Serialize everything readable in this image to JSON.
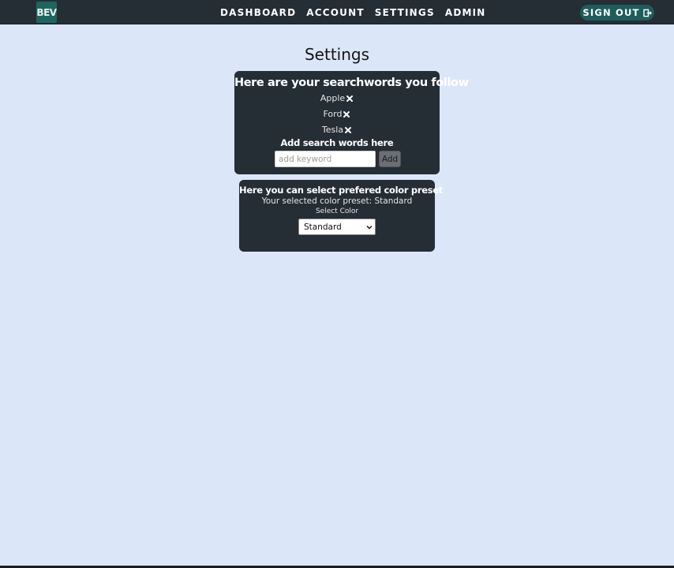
{
  "nav": {
    "logo": "BEV",
    "links": [
      "DASHBOARD",
      "ACCOUNT",
      "SETTINGS",
      "ADMIN"
    ],
    "signout_label": "SIGN OUT",
    "signout_icon": "sign-out-icon"
  },
  "page": {
    "title": "Settings"
  },
  "searchwords": {
    "title": "Here are your searchwords you follow",
    "keywords": [
      "Apple",
      "Ford",
      "Tesla"
    ],
    "remove_icon": "close-icon",
    "add_label": "Add search words here",
    "input_placeholder": "add keyword",
    "input_value": "",
    "add_button": "Add"
  },
  "color_preset": {
    "title": "Here you can select prefered color preset",
    "selected_text": "Your selected color preset: Standard",
    "select_label": "Select Color",
    "selected_value": "Standard"
  },
  "colors": {
    "nav_bg": "#252d35",
    "page_bg": "#dce6f9",
    "card_bg": "#252d35",
    "signout_bg": "#1f5c5c",
    "logo_bg": "#1d6660"
  }
}
